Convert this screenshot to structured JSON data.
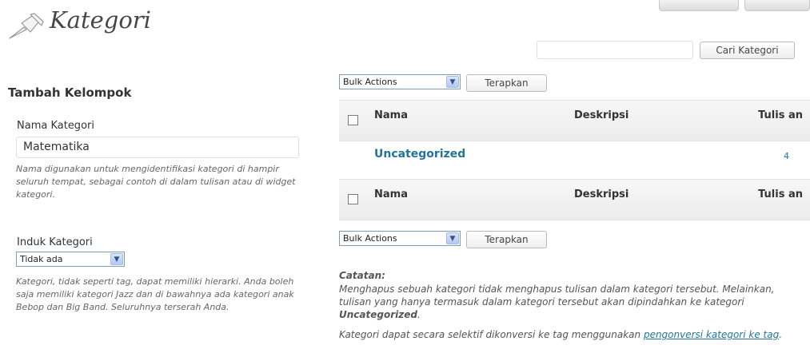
{
  "header": {
    "title": "Kategori",
    "icon": "pushpin-icon"
  },
  "search": {
    "value": "",
    "placeholder": "",
    "button_label": "Cari Kategori"
  },
  "add_form": {
    "heading": "Tambah Kelompok",
    "name_label": "Nama Kategori",
    "name_value": "Matematika",
    "name_help": "Nama digunakan untuk mengidentifikasi kategori di hampir seluruh tempat, sebagai contoh di dalam tulisan atau di widget kategori.",
    "parent_label": "Induk Kategori",
    "parent_selected": "Tidak ada",
    "parent_help": "Kategori, tidak seperti tag, dapat memiliki hierarki. Anda boleh saja memiliki kategori Jazz dan di bawahnya ada kategori anak Bebop dan Big Band. Seluruhnya terserah Anda."
  },
  "bulk": {
    "selected": "Bulk Actions",
    "apply_label": "Terapkan"
  },
  "table": {
    "columns": {
      "name": "Nama",
      "description": "Deskripsi",
      "count": "Tulis an"
    },
    "rows": [
      {
        "name": "Uncategorized",
        "description": "",
        "count": "4"
      }
    ]
  },
  "notes": {
    "title": "Catatan:",
    "text_before": "Menghapus sebuah kategori tidak menghapus tulisan dalam kategori tersebut. Melainkan, tulisan yang hanya termasuk dalam kategori tersebut akan dipindahkan ke kategori ",
    "text_bold": "Uncategorized",
    "text_after": ".",
    "convert_before": "Kategori dapat secara selektif dikonversi ke tag menggunakan ",
    "convert_link": "pengonversi kategori ke tag",
    "convert_after": "."
  },
  "colors": {
    "link": "#21759b",
    "header_bg": "#ececec"
  }
}
